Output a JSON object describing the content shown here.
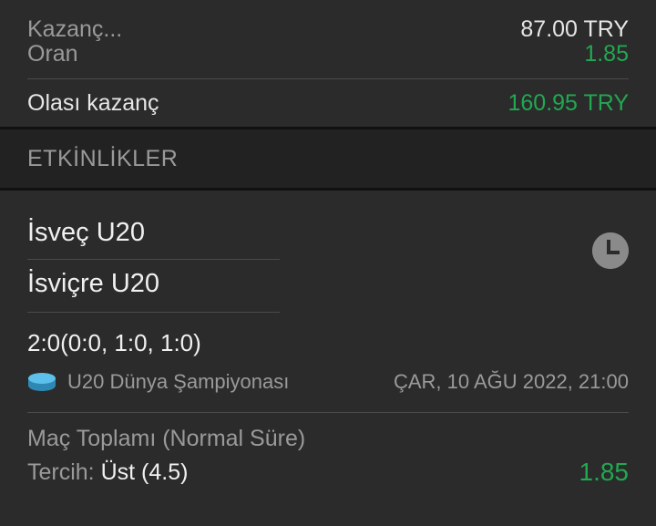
{
  "summary": {
    "stake_label": "Kazanç...",
    "stake_value": "87.00 TRY",
    "odds_label": "Oran",
    "odds_value": "1.85",
    "potential_label": "Olası kazanç",
    "potential_value": "160.95 TRY"
  },
  "events_header": "ETKİNLİKLER",
  "event": {
    "home": "İsveç U20",
    "away": "İsviçre U20",
    "score": "2:0(0:0, 1:0, 1:0)",
    "competition": "U20 Dünya Şampiyonası",
    "datetime": "ÇAR, 10 AĞU 2022, 21:00",
    "market": "Maç Toplamı (Normal Süre)",
    "pick_label": "Tercih:",
    "pick_value": "Üst (4.5)",
    "pick_odds": "1.85",
    "sport_icon": "hockey-puck-icon",
    "status_icon": "clock-icon"
  },
  "colors": {
    "green": "#21a851",
    "puck": "#3aa8d8",
    "background": "#2b2b2b"
  }
}
